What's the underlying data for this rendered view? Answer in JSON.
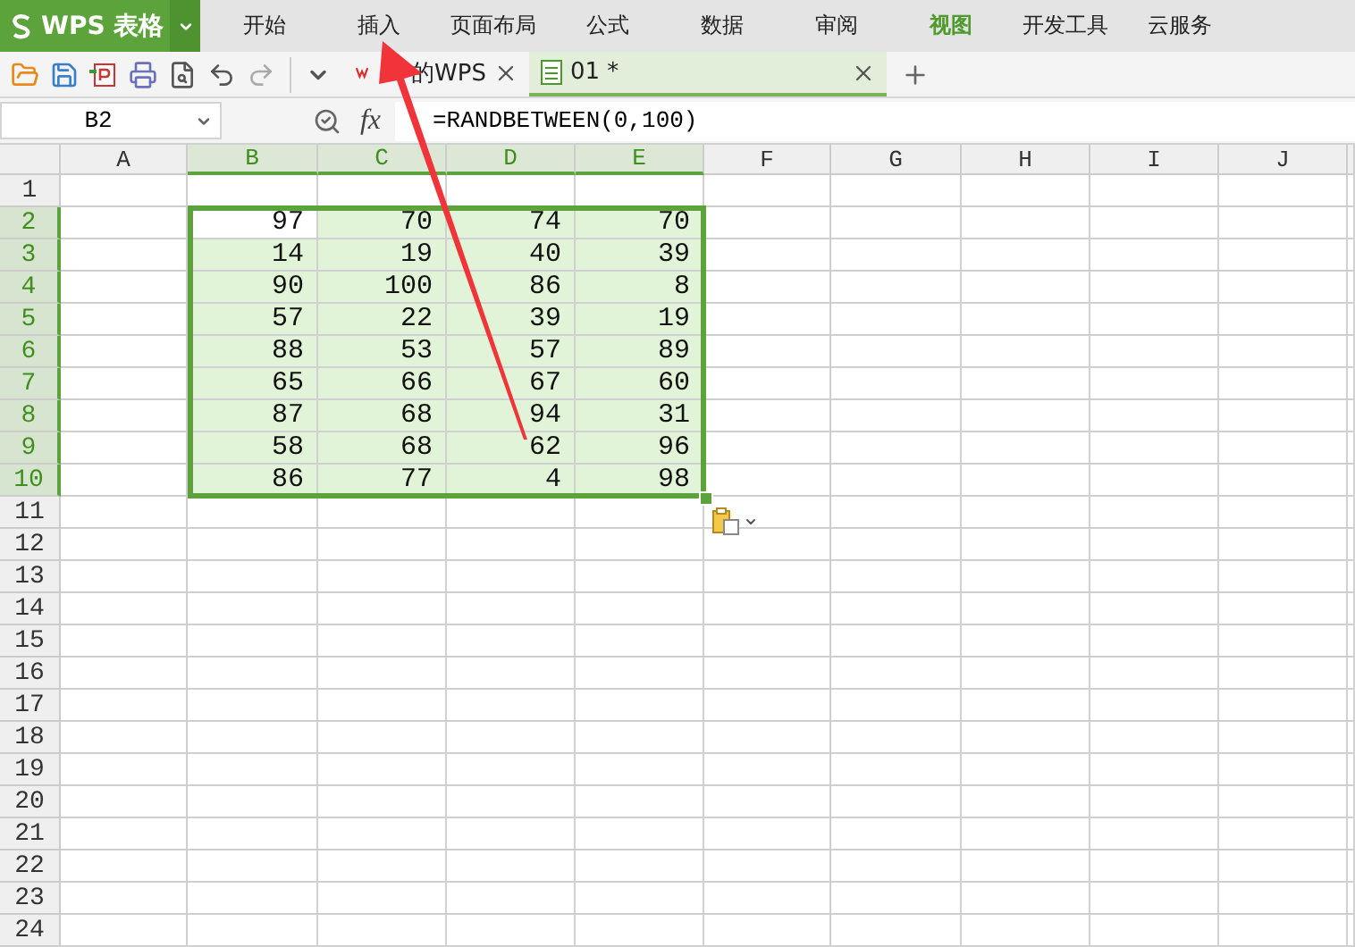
{
  "app_menu": {
    "logo_text": "WPS 表格"
  },
  "menu_tabs": [
    {
      "label": "开始",
      "selected": false
    },
    {
      "label": "插入",
      "selected": false
    },
    {
      "label": "页面布局",
      "selected": false
    },
    {
      "label": "公式",
      "selected": false
    },
    {
      "label": "数据",
      "selected": false
    },
    {
      "label": "审阅",
      "selected": false
    },
    {
      "label": "视图",
      "selected": true
    },
    {
      "label": "开发工具",
      "selected": false
    },
    {
      "label": "云服务",
      "selected": false
    }
  ],
  "doc_tabs": [
    {
      "kind": "home",
      "label": "的WPS",
      "selected": false
    },
    {
      "kind": "sheet",
      "label": "01 *",
      "selected": true
    }
  ],
  "formula_bar": {
    "name_box": "B2",
    "fx": "fx",
    "formula": "=RANDBETWEEN(0,100)"
  },
  "sheet": {
    "columns": [
      {
        "label": "A",
        "selected": false
      },
      {
        "label": "B",
        "selected": true
      },
      {
        "label": "C",
        "selected": true
      },
      {
        "label": "D",
        "selected": true
      },
      {
        "label": "E",
        "selected": true
      },
      {
        "label": "F",
        "selected": false
      },
      {
        "label": "G",
        "selected": false
      },
      {
        "label": "H",
        "selected": false
      },
      {
        "label": "I",
        "selected": false
      },
      {
        "label": "J",
        "selected": false
      }
    ],
    "rows": [
      {
        "label": "1",
        "selected": false
      },
      {
        "label": "2",
        "selected": true,
        "cells": [
          {
            "value": "97",
            "active": true
          },
          {
            "value": "70",
            "active": false
          },
          {
            "value": "74",
            "active": false
          },
          {
            "value": "70",
            "active": false
          }
        ]
      },
      {
        "label": "3",
        "selected": true,
        "cells": [
          {
            "value": "14",
            "active": false
          },
          {
            "value": "19",
            "active": false
          },
          {
            "value": "40",
            "active": false
          },
          {
            "value": "39",
            "active": false
          }
        ]
      },
      {
        "label": "4",
        "selected": true,
        "cells": [
          {
            "value": "90",
            "active": false
          },
          {
            "value": "100",
            "active": false
          },
          {
            "value": "86",
            "active": false
          },
          {
            "value": "8",
            "active": false
          }
        ]
      },
      {
        "label": "5",
        "selected": true,
        "cells": [
          {
            "value": "57",
            "active": false
          },
          {
            "value": "22",
            "active": false
          },
          {
            "value": "39",
            "active": false
          },
          {
            "value": "19",
            "active": false
          }
        ]
      },
      {
        "label": "6",
        "selected": true,
        "cells": [
          {
            "value": "88",
            "active": false
          },
          {
            "value": "53",
            "active": false
          },
          {
            "value": "57",
            "active": false
          },
          {
            "value": "89",
            "active": false
          }
        ]
      },
      {
        "label": "7",
        "selected": true,
        "cells": [
          {
            "value": "65",
            "active": false
          },
          {
            "value": "66",
            "active": false
          },
          {
            "value": "67",
            "active": false
          },
          {
            "value": "60",
            "active": false
          }
        ]
      },
      {
        "label": "8",
        "selected": true,
        "cells": [
          {
            "value": "87",
            "active": false
          },
          {
            "value": "68",
            "active": false
          },
          {
            "value": "94",
            "active": false
          },
          {
            "value": "31",
            "active": false
          }
        ]
      },
      {
        "label": "9",
        "selected": true,
        "cells": [
          {
            "value": "58",
            "active": false
          },
          {
            "value": "68",
            "active": false
          },
          {
            "value": "62",
            "active": false
          },
          {
            "value": "96",
            "active": false
          }
        ]
      },
      {
        "label": "10",
        "selected": true,
        "cells": [
          {
            "value": "86",
            "active": false
          },
          {
            "value": "77",
            "active": false
          },
          {
            "value": "4",
            "active": false
          },
          {
            "value": "98",
            "active": false
          }
        ]
      },
      {
        "label": "11",
        "selected": false
      },
      {
        "label": "12",
        "selected": false
      },
      {
        "label": "13",
        "selected": false
      },
      {
        "label": "14",
        "selected": false
      },
      {
        "label": "15",
        "selected": false
      },
      {
        "label": "16",
        "selected": false
      },
      {
        "label": "17",
        "selected": false
      },
      {
        "label": "18",
        "selected": false
      },
      {
        "label": "19",
        "selected": false
      },
      {
        "label": "20",
        "selected": false
      },
      {
        "label": "21",
        "selected": false
      },
      {
        "label": "22",
        "selected": false
      },
      {
        "label": "23",
        "selected": false
      },
      {
        "label": "24",
        "selected": false
      }
    ]
  }
}
